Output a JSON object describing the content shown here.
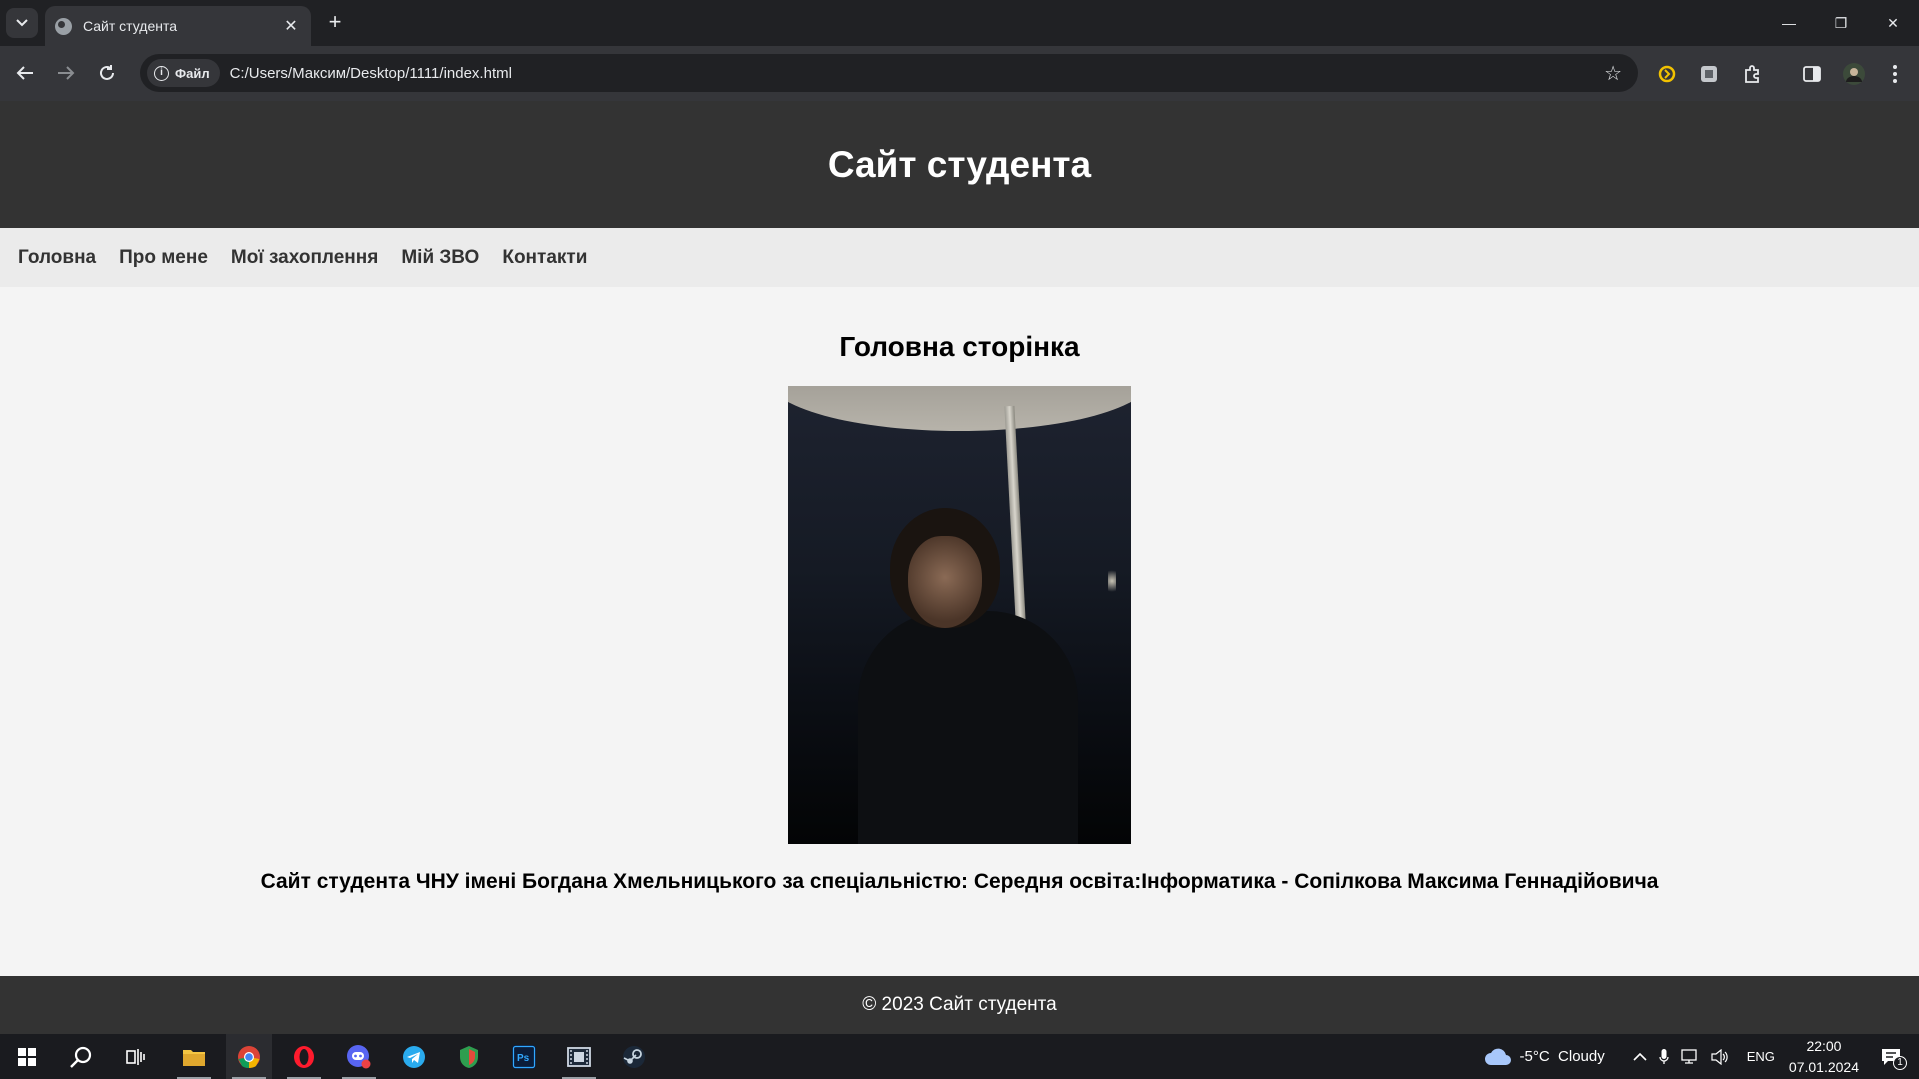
{
  "browser": {
    "tab_title": "Сайт студента",
    "site_chip_label": "Файл",
    "url": "C:/Users/Максим/Desktop/1111/index.html"
  },
  "page": {
    "header_title": "Сайт студента",
    "nav": [
      {
        "label": "Головна"
      },
      {
        "label": "Про мене"
      },
      {
        "label": "Мої захоплення"
      },
      {
        "label": "Мій ЗВО"
      },
      {
        "label": "Контакти"
      }
    ],
    "section_title": "Головна сторінка",
    "description": "Сайт студента ЧНУ імені Богдана Хмельницького за спеціальністю: Середня освіта:Інформатика - Сопілкова Максима Геннадійовича",
    "footer": "© 2023 Сайт студента"
  },
  "taskbar": {
    "weather": "-5°C  Cloudy",
    "language": "ENG",
    "time": "22:00",
    "date": "07.01.2024",
    "notifications_count": "1"
  },
  "colors": {
    "header_bg": "#333333",
    "nav_bg": "#ebebeb",
    "page_bg": "#f4f4f4"
  }
}
